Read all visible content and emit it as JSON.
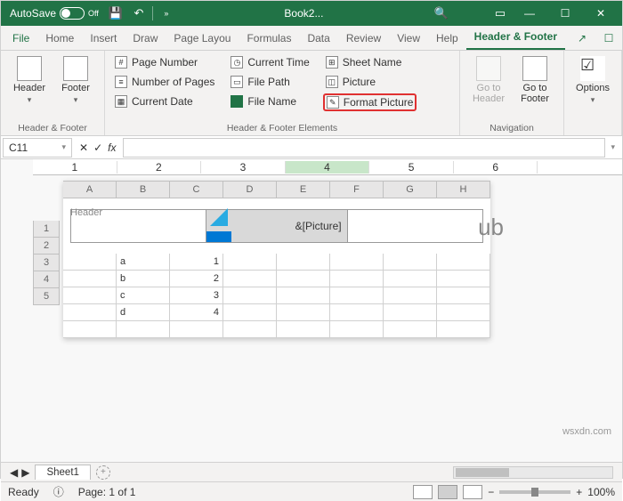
{
  "titlebar": {
    "autosave": "AutoSave",
    "off": "Off",
    "title": "Book2..."
  },
  "tabs": [
    "File",
    "Home",
    "Insert",
    "Draw",
    "Page Layou",
    "Formulas",
    "Data",
    "Review",
    "View",
    "Help",
    "Header & Footer"
  ],
  "activeTab": "Header & Footer",
  "ribbon": {
    "g1": {
      "label": "Header & Footer",
      "header": "Header",
      "footer": "Footer"
    },
    "g2": {
      "label": "Header & Footer Elements",
      "c": [
        "Page Number",
        "Number of Pages",
        "Current Date",
        "Current Time",
        "File Path",
        "File Name",
        "Sheet Name",
        "Picture",
        "Format Picture"
      ]
    },
    "g3": {
      "label": "Navigation",
      "goh": "Go to Header",
      "gof": "Go to Footer"
    },
    "g4": {
      "opt": "Options"
    }
  },
  "namebox": "C11",
  "ruler": [
    "1",
    "2",
    "3",
    "4",
    "5",
    "6"
  ],
  "cols": [
    "A",
    "B",
    "C",
    "D",
    "E",
    "F",
    "G",
    "H"
  ],
  "rows": [
    "1",
    "2",
    "3",
    "4",
    "5"
  ],
  "headerLabel": "Header",
  "headerCenter": "&[Picture]",
  "watermark": "ub",
  "cells": [
    [
      "",
      "a",
      "1",
      "",
      "",
      "",
      "",
      ""
    ],
    [
      "",
      "b",
      "2",
      "",
      "",
      "",
      "",
      ""
    ],
    [
      "",
      "c",
      "3",
      "",
      "",
      "",
      "",
      ""
    ],
    [
      "",
      "d",
      "4",
      "",
      "",
      "",
      "",
      ""
    ],
    [
      "",
      "",
      "",
      "",
      "",
      "",
      "",
      ""
    ]
  ],
  "sheettab": "Sheet1",
  "status": {
    "ready": "Ready",
    "page": "Page: 1 of 1",
    "zoom": "100%"
  },
  "site": "wsxdn.com"
}
